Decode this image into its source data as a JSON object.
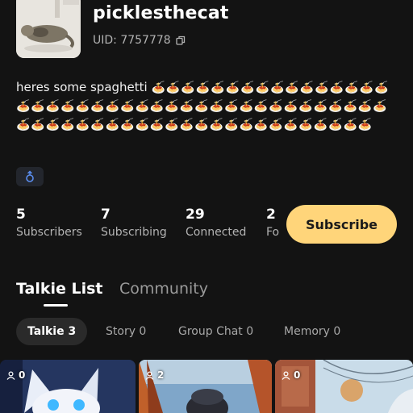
{
  "profile": {
    "username": "picklesthecat",
    "uid": "UID: 7757778",
    "bio_text": "heres some spaghetti",
    "bio_emoji": "🍝🍝🍝🍝🍝🍝🍝🍝🍝🍝🍝🍝🍝🍝🍝🍝🍝🍝🍝🍝🍝🍝🍝🍝🍝🍝🍝🍝🍝🍝🍝🍝🍝🍝🍝🍝🍝🍝🍝🍝🍝🍝🍝🍝🍝🍝🍝🍝🍝🍝🍝🍝🍝🍝🍝🍝🍝🍝🍝🍝🍝🍝🍝🍝🍝"
  },
  "stats": [
    {
      "value": "5",
      "label": "Subscribers"
    },
    {
      "value": "7",
      "label": "Subscribing"
    },
    {
      "value": "29",
      "label": "Connected"
    },
    {
      "value": "2",
      "label": "Fo"
    }
  ],
  "subscribe_label": "Subscribe",
  "tabs": {
    "active": "Talkie List",
    "inactive": "Community"
  },
  "subtabs": [
    "Talkie 3",
    "Story 0",
    "Group Chat 0",
    "Memory 0"
  ],
  "cards": [
    {
      "count": "0"
    },
    {
      "count": "2"
    },
    {
      "count": "0"
    }
  ],
  "colors": {
    "accent": "#ffd57a",
    "background": "#131313"
  }
}
